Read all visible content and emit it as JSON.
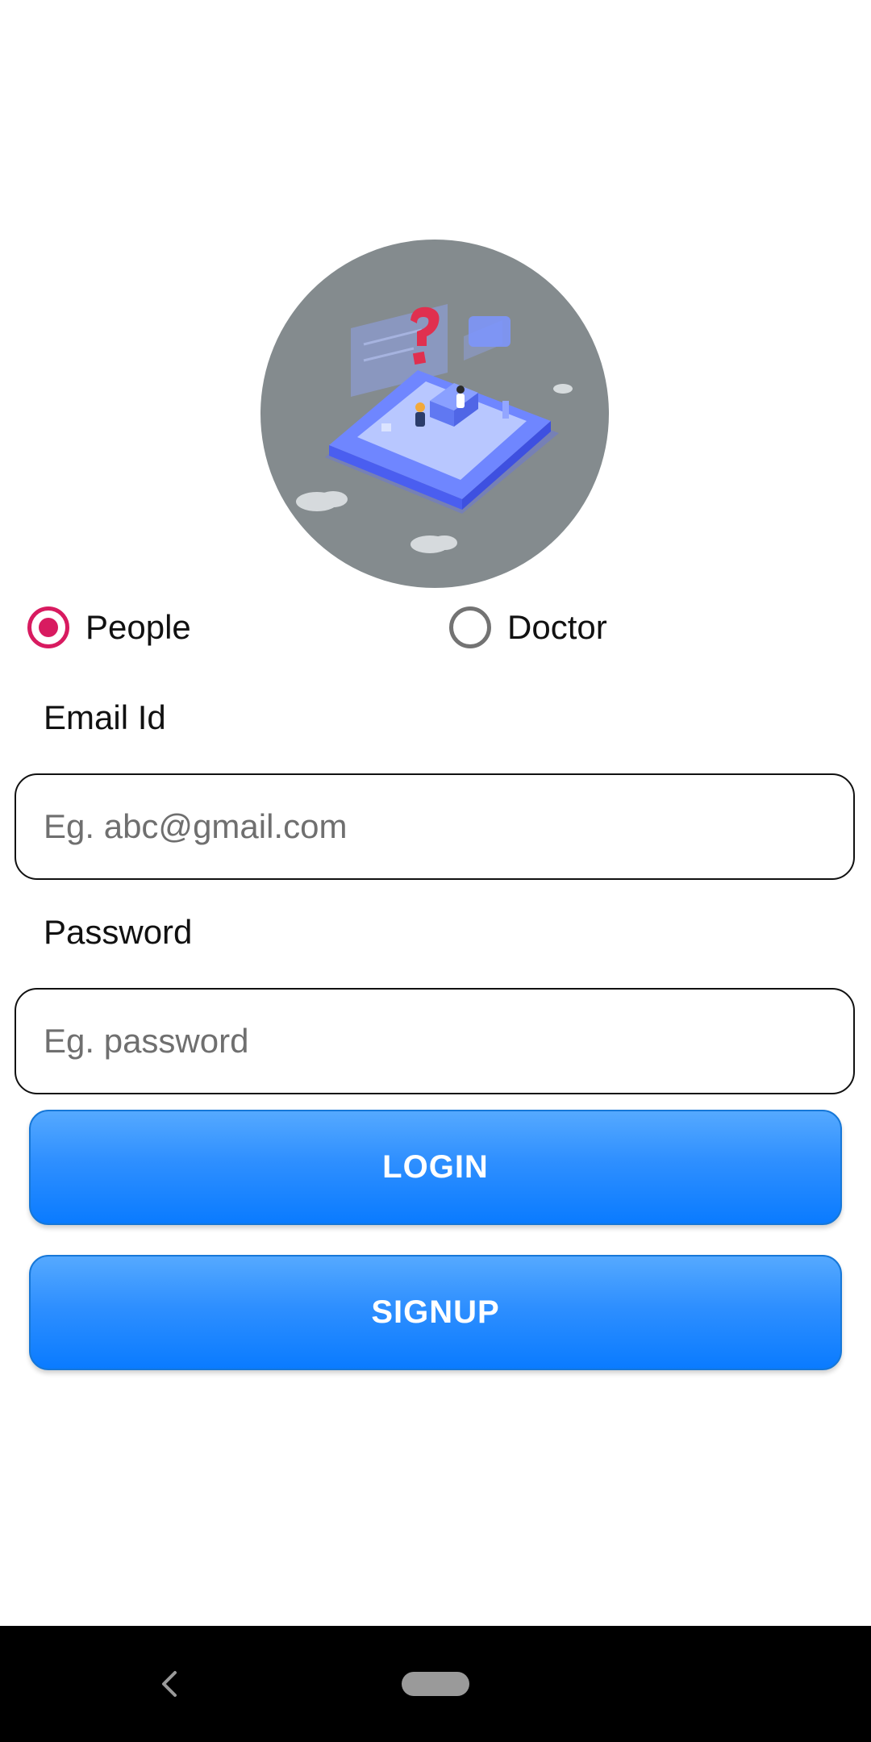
{
  "illustration": {
    "icon": "isometric-phone-support-illustration",
    "background_color": "#848b8e"
  },
  "user_type": {
    "options": [
      {
        "label": "People",
        "selected": true
      },
      {
        "label": "Doctor",
        "selected": false
      }
    ],
    "accent_color": "#d81b60"
  },
  "email": {
    "label": "Email Id",
    "placeholder": "Eg. abc@gmail.com",
    "value": ""
  },
  "password": {
    "label": "Password",
    "placeholder": "Eg. password",
    "value": ""
  },
  "buttons": {
    "login_label": "LOGIN",
    "signup_label": "SIGNUP",
    "color": "#0a7bff"
  },
  "nav_bar": {
    "back_icon": "back-chevron-icon",
    "home_icon": "home-pill-icon"
  }
}
